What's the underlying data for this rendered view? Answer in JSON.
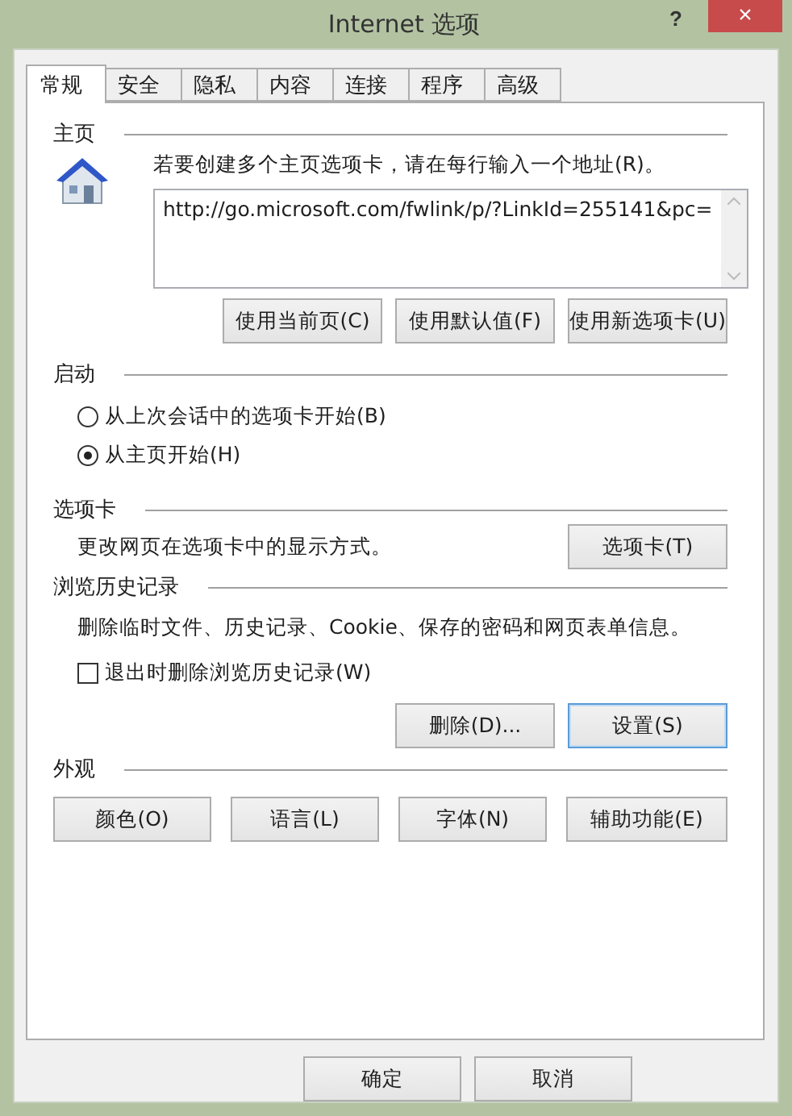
{
  "window": {
    "title": "Internet 选项",
    "help": "?",
    "close": "×"
  },
  "tabs": [
    {
      "label": "常规",
      "selected": true
    },
    {
      "label": "安全",
      "selected": false
    },
    {
      "label": "隐私",
      "selected": false
    },
    {
      "label": "内容",
      "selected": false
    },
    {
      "label": "连接",
      "selected": false
    },
    {
      "label": "程序",
      "selected": false
    },
    {
      "label": "高级",
      "selected": false
    }
  ],
  "homepage": {
    "heading": "主页",
    "instruction": "若要创建多个主页选项卡，请在每行输入一个地址(R)。",
    "value": "http://go.microsoft.com/fwlink/p/?LinkId=255141&pc=",
    "buttons": [
      "使用当前页(C)",
      "使用默认值(F)",
      "使用新选项卡(U)"
    ]
  },
  "startup": {
    "heading": "启动",
    "options": [
      {
        "label": "从上次会话中的选项卡开始(B)",
        "selected": false
      },
      {
        "label": "从主页开始(H)",
        "selected": true
      }
    ]
  },
  "tabs_section": {
    "heading": "选项卡",
    "description": "更改网页在选项卡中的显示方式。",
    "button": "选项卡(T)"
  },
  "history": {
    "heading": "浏览历史记录",
    "description": "删除临时文件、历史记录、Cookie、保存的密码和网页表单信息。",
    "checkbox": {
      "label": "退出时删除浏览历史记录(W)",
      "checked": false
    },
    "buttons": [
      {
        "label": "删除(D)...",
        "focused": false
      },
      {
        "label": "设置(S)",
        "focused": true
      }
    ]
  },
  "appearance": {
    "heading": "外观",
    "buttons": [
      "颜色(O)",
      "语言(L)",
      "字体(N)",
      "辅助功能(E)"
    ]
  },
  "footer_buttons": [
    "确定",
    "取消"
  ]
}
